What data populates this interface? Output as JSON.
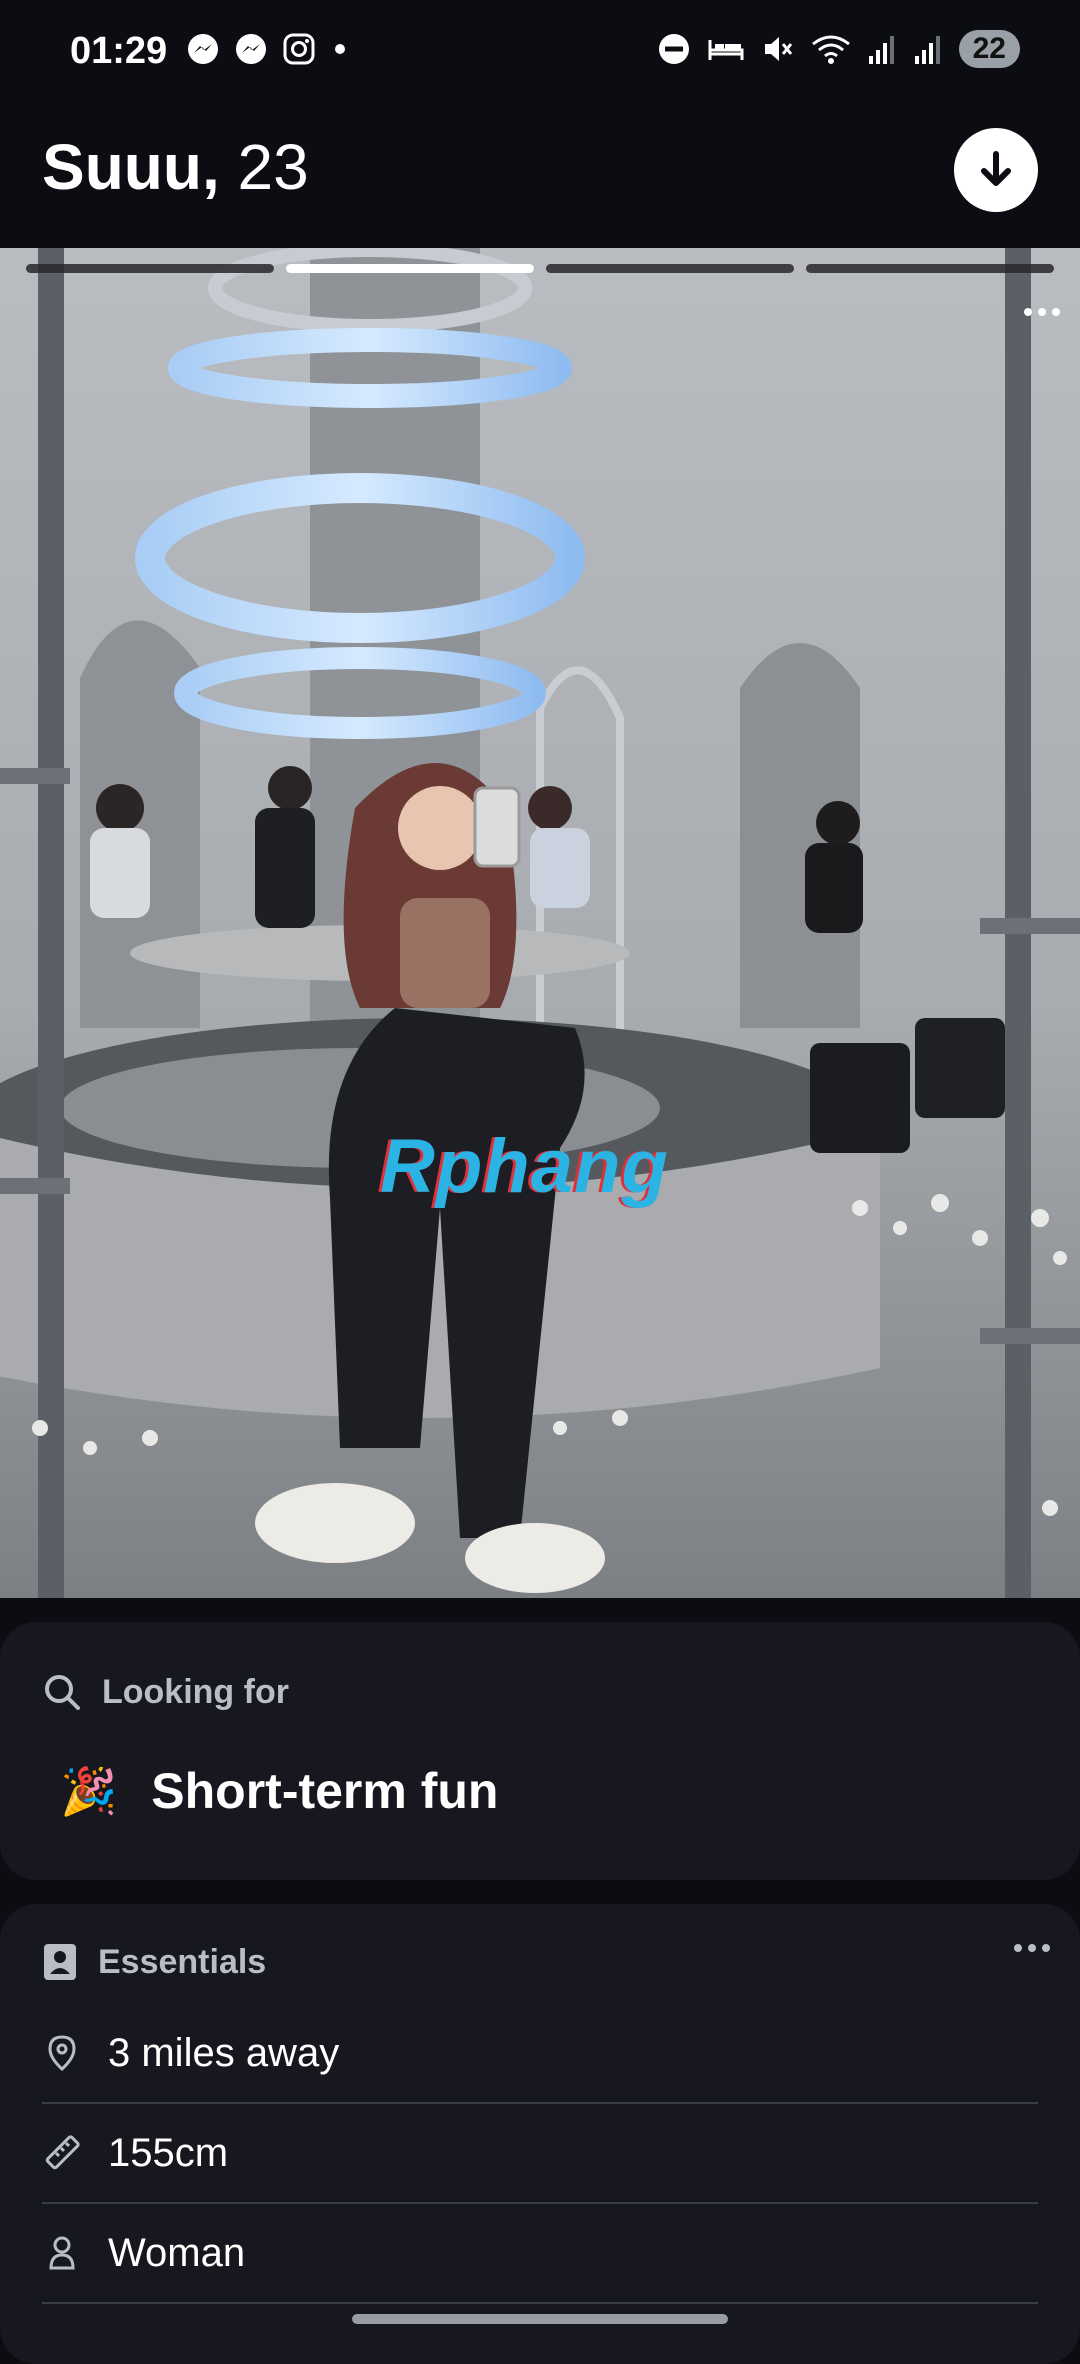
{
  "status_bar": {
    "time": "01:29",
    "battery": "22",
    "left_icons": [
      "messenger-icon",
      "messenger-icon",
      "instagram-icon",
      "dot-icon"
    ],
    "right_icons": [
      "do-not-disturb-icon",
      "bed-icon",
      "mute-icon",
      "wifi-icon",
      "signal-icon",
      "signal-icon"
    ]
  },
  "profile": {
    "name": "Suuu,",
    "age": "23"
  },
  "photo": {
    "total": 4,
    "current": 2,
    "watermark": "Rphang"
  },
  "looking_for": {
    "header": "Looking for",
    "emoji": "🎉",
    "value": "Short-term fun"
  },
  "essentials": {
    "header": "Essentials",
    "items": [
      {
        "icon": "location-pin-icon",
        "label": "3 miles away"
      },
      {
        "icon": "ruler-icon",
        "label": "155cm"
      },
      {
        "icon": "person-icon",
        "label": "Woman"
      }
    ]
  },
  "colors": {
    "background": "#0c0d12",
    "card": "#17181f",
    "muted_text": "#b9bdc6",
    "accent": "#ffffff"
  }
}
